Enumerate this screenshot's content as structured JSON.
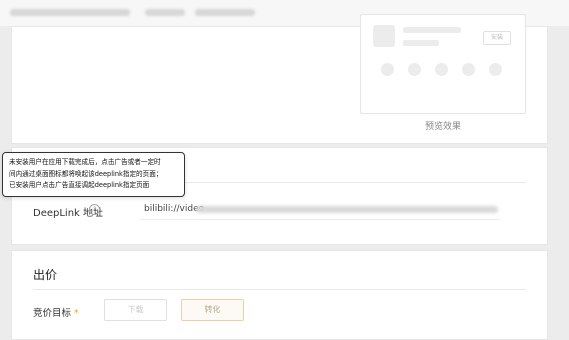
{
  "preview": {
    "button_label": "安装",
    "caption": "预览效果"
  },
  "tooltip": {
    "lines": [
      "未安装用户在应用下载完成后，点击广告或者一定时",
      "间内通过桌面图标都将唤起该deeplink指定的页面；",
      "已安装用户点击广告直接调起deeplink指定页面"
    ]
  },
  "deeplink": {
    "label": "DeepLink 地址",
    "help_icon": "?",
    "value": "bilibili://video"
  },
  "bid": {
    "section_title": "出价",
    "target_label": "竞价目标",
    "required_mark": "*",
    "options": [
      "下载",
      "转化"
    ],
    "selected_option": "转化"
  },
  "colors": {
    "accent_border": "#f1cfa4",
    "required_star": "#f5a623"
  }
}
